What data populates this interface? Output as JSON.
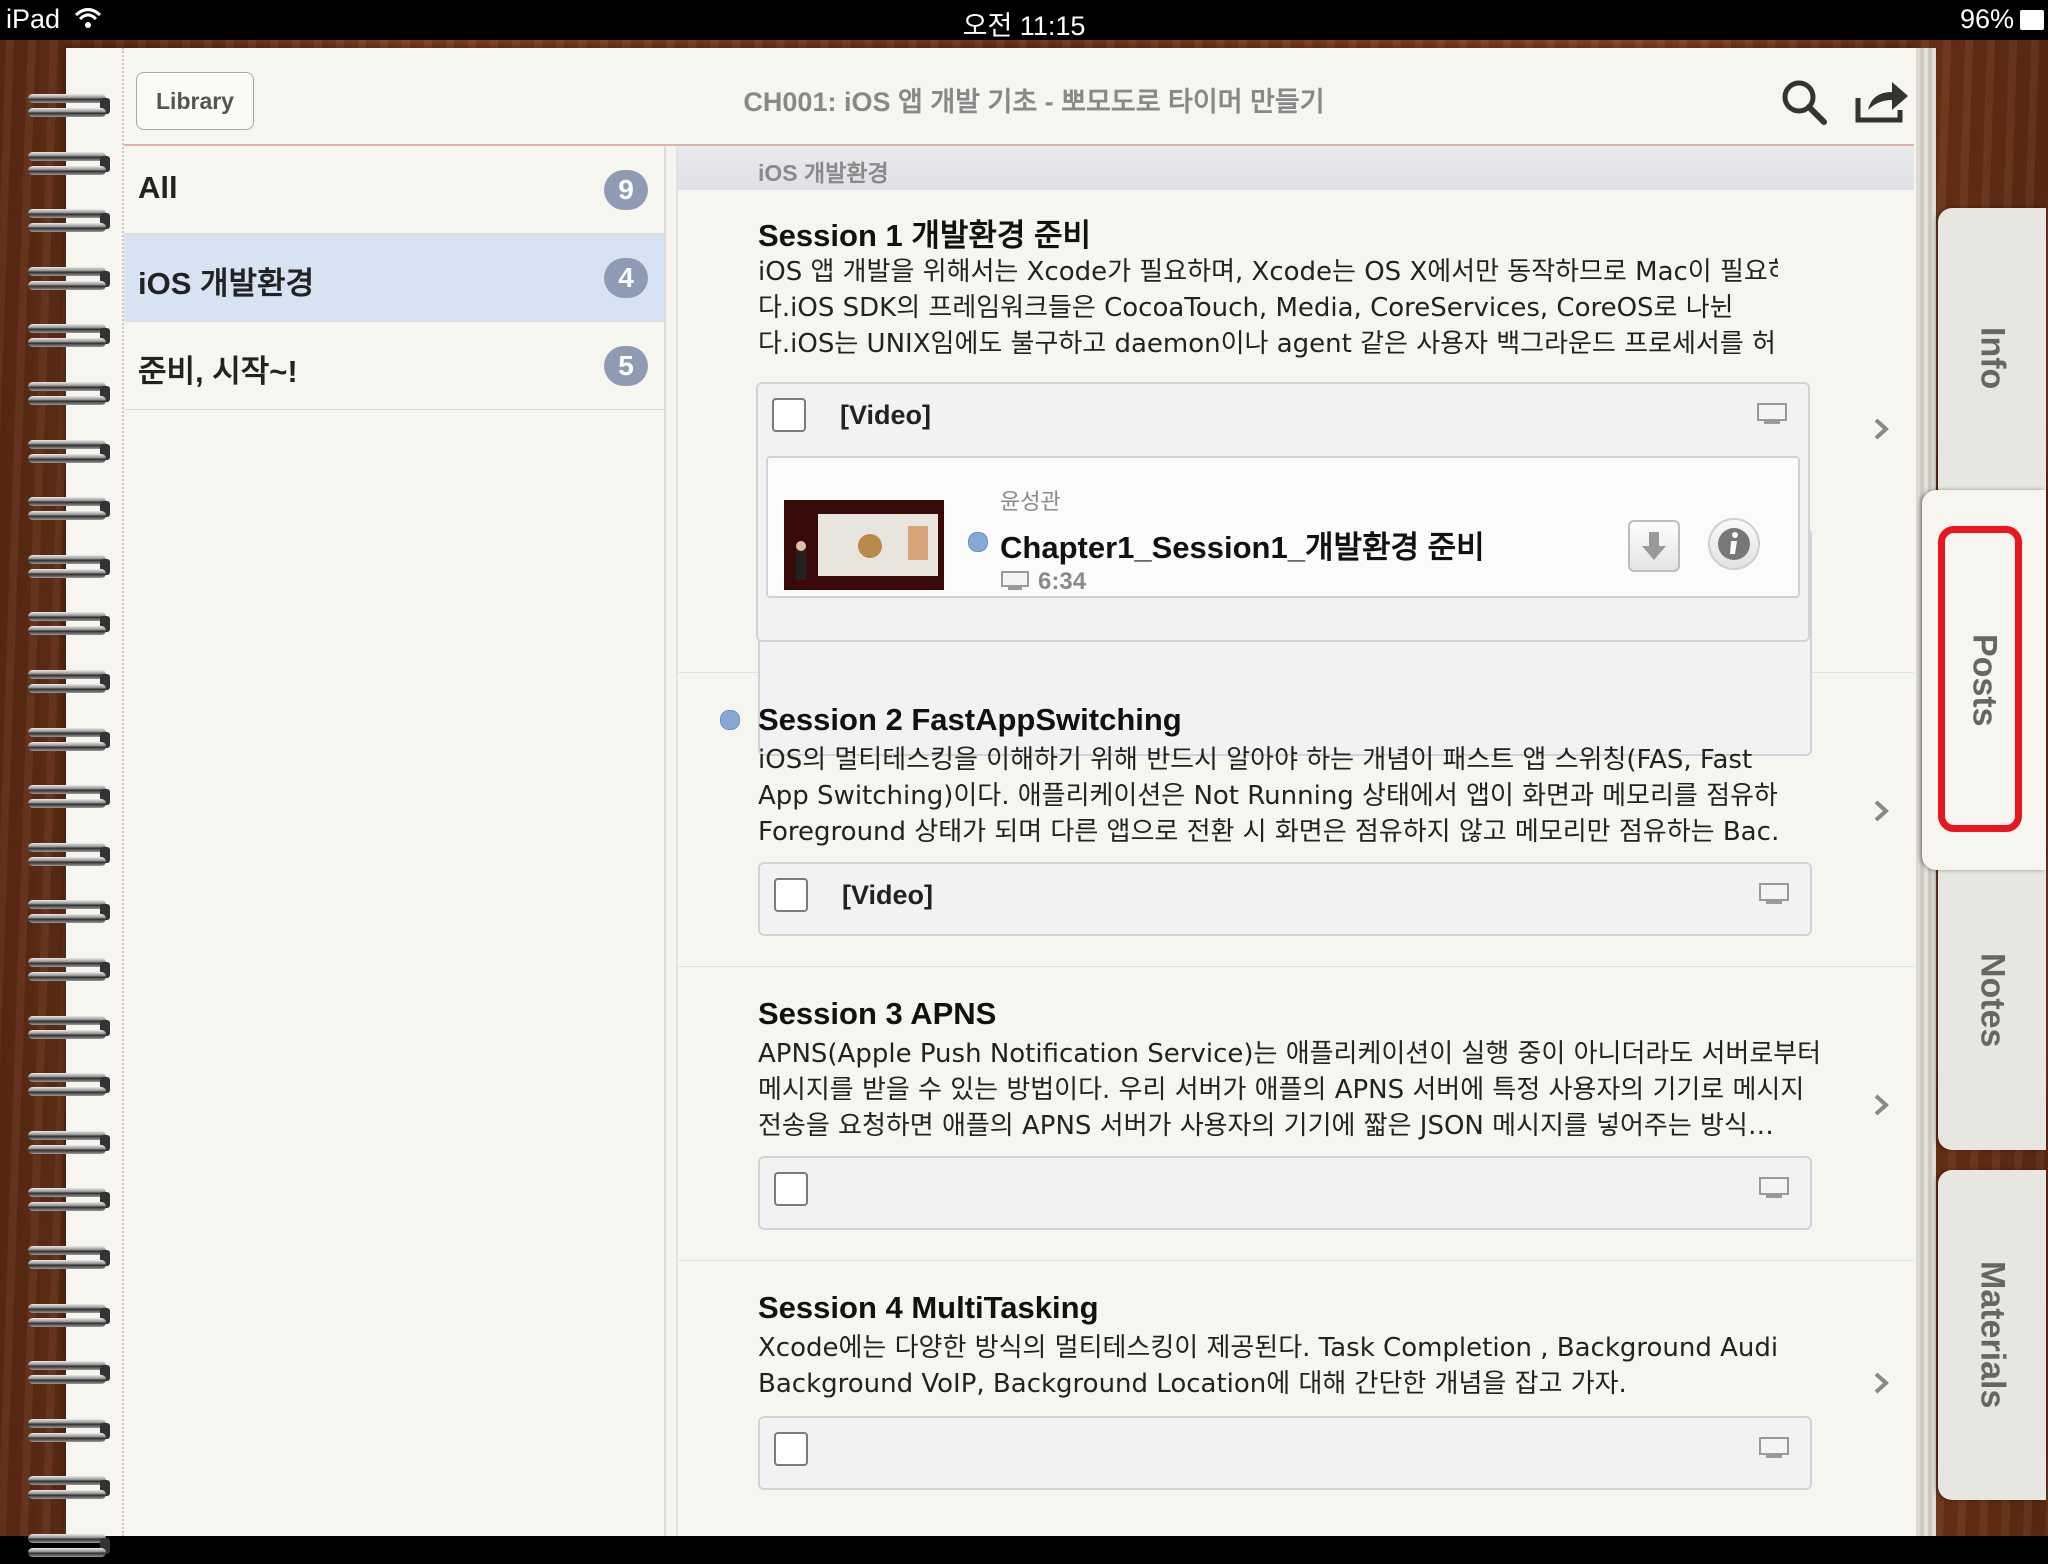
{
  "status_bar": {
    "carrier": "iPad",
    "time": "오전 11:15",
    "battery": "96%"
  },
  "header": {
    "library_label": "Library",
    "title": "CH001: iOS 앱 개발 기초 - 뽀모도로 타이머 만들기"
  },
  "categories": [
    {
      "label": "All",
      "count": "9",
      "selected": false
    },
    {
      "label": "iOS 개발환경",
      "count": "4",
      "selected": true
    },
    {
      "label": "준비, 시작~!",
      "count": "5",
      "selected": false
    }
  ],
  "section_header": "iOS 개발환경",
  "sessions": [
    {
      "title": "Session 1 개발환경 준비",
      "desc_lines": [
        "iOS 앱 개발을 위해서는 Xcode가 필요하며, Xcode는 OS X에서만 동작하므로 Mac이 필요하",
        "다.iOS SDK의 프레임워크들은 CocoaTouch, Media, CoreServices, CoreOS로 나뉜",
        "다.iOS는 UNIX임에도 불구하고 daemon이나 agent 같은 사용자 백그라운드 프로세서를 허…"
      ],
      "attachment_label": "[Video]",
      "media": {
        "author": "윤성관",
        "title": "Chapter1_Session1_개발환경 준비",
        "duration": "6:34"
      }
    },
    {
      "title": "Session 2 FastAppSwitching",
      "desc_lines": [
        "iOS의 멀티테스킹을 이해하기 위해 반드시 알아야 하는 개념이 패스트 앱 스위칭(FAS, Fast",
        "App Switching)이다. 애플리케이션은 Not Running 상태에서 앱이 화면과 메모리를 점유하는",
        "Foreground 상태가 되며 다른 앱으로 전환 시 화면은 점유하지 않고 메모리만 점유하는 Bac…"
      ],
      "attachment_label": "[Video]"
    },
    {
      "title": "Session 3 APNS",
      "desc_lines": [
        "APNS(Apple Push Notification Service)는 애플리케이션이 실행 중이 아니더라도 서버로부터",
        "메시지를 받을 수 있는 방법이다. 우리 서버가 애플의 APNS 서버에 특정 사용자의 기기로 메시지",
        "전송을 요청하면 애플의 APNS 서버가 사용자의 기기에 짧은 JSON 메시지를 넣어주는 방식…"
      ],
      "attachment_label": ""
    },
    {
      "title": "Session 4 MultiTasking",
      "desc_lines": [
        "Xcode에는 다양한 방식의 멀티테스킹이 제공된다. Task Completion , Background Audio,",
        "Background VoIP, Background Location에 대해 간단한 개념을 잡고 가자."
      ],
      "attachment_label": ""
    }
  ],
  "tabs": [
    {
      "label": "Info",
      "active": false
    },
    {
      "label": "Posts",
      "active": true
    },
    {
      "label": "Notes",
      "active": false
    },
    {
      "label": "Materials",
      "active": false
    }
  ],
  "colors": {
    "wood": "#7a3718",
    "paper": "#f6f5f0",
    "badge": "#8e9bb3",
    "selected_row": "#d7e3f2",
    "unread_dot": "#86a8d4",
    "highlight": "#e8161d"
  }
}
